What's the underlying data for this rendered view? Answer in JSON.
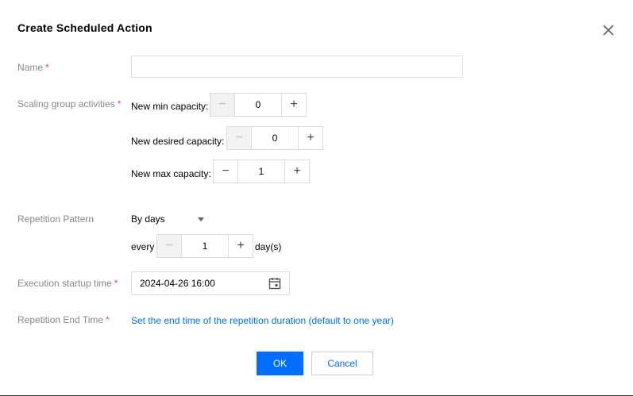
{
  "dialog": {
    "title": "Create Scheduled Action",
    "close_icon": "close-icon"
  },
  "form": {
    "name": {
      "label": "Name",
      "required_mark": "*",
      "value": "",
      "placeholder": ""
    },
    "scaling": {
      "label": "Scaling group activities",
      "required_mark": "*",
      "min": {
        "label": "New min capacity:",
        "value": "0",
        "minus": "−",
        "plus": "+"
      },
      "desired": {
        "label": "New desired capacity:",
        "value": "0",
        "minus": "−",
        "plus": "+"
      },
      "max": {
        "label": "New max capacity:",
        "value": "1",
        "minus": "−",
        "plus": "+"
      }
    },
    "repetition": {
      "label": "Repetition Pattern",
      "selected": "By days",
      "every_label": "every",
      "every_value": "1",
      "minus": "−",
      "plus": "+",
      "unit": "day(s)"
    },
    "startup": {
      "label": "Execution startup time",
      "required_mark": "*",
      "value": "2024-04-26 16:00",
      "icon": "calendar-icon"
    },
    "end_time": {
      "label": "Repetition End Time",
      "required_mark": "*",
      "link": "Set the end time of the repetition duration (default to one year)"
    }
  },
  "footer": {
    "ok_label": "OK",
    "cancel_label": "Cancel"
  },
  "colors": {
    "primary": "#006eff",
    "required": "#e54545",
    "label": "#888888"
  }
}
